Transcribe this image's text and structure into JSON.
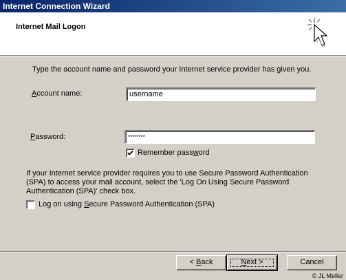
{
  "window": {
    "title": "Internet Connection Wizard"
  },
  "header": {
    "title": "Internet Mail Logon",
    "icon": "wizard-cursor-icon"
  },
  "form": {
    "intro": "Type the account name and password your Internet service provider has given you.",
    "account_label_prefix": "A",
    "account_label_rest": "ccount name:",
    "account_value": "username",
    "password_label_prefix": "P",
    "password_label_rest": "assword:",
    "password_value": "********",
    "remember_prefix": "Remember pass",
    "remember_mnemonic": "w",
    "remember_rest": "ord",
    "remember_checked": true
  },
  "spa": {
    "line1": "If your Internet service provider requires you to use Secure Password Authentication",
    "line2": "(SPA) to access your mail account, select the 'Log On Using Secure Password",
    "line3": "Authentication (SPA)' check box.",
    "checkbox_prefix": "Log on using ",
    "checkbox_mnemonic": "S",
    "checkbox_rest": "ecure Password Authentication (SPA)",
    "checkbox_checked": false
  },
  "buttons": {
    "back_arrow": "< ",
    "back_mnemonic": "B",
    "back_rest": "ack",
    "next_mnemonic": "N",
    "next_rest": "ext >",
    "cancel": "Cancel"
  },
  "footer": {
    "copyright": "© JL Meller"
  },
  "colors": {
    "titlebar_start": "#0a246a",
    "titlebar_end": "#3a6ea5",
    "dialog_face": "#d4d0c8"
  }
}
